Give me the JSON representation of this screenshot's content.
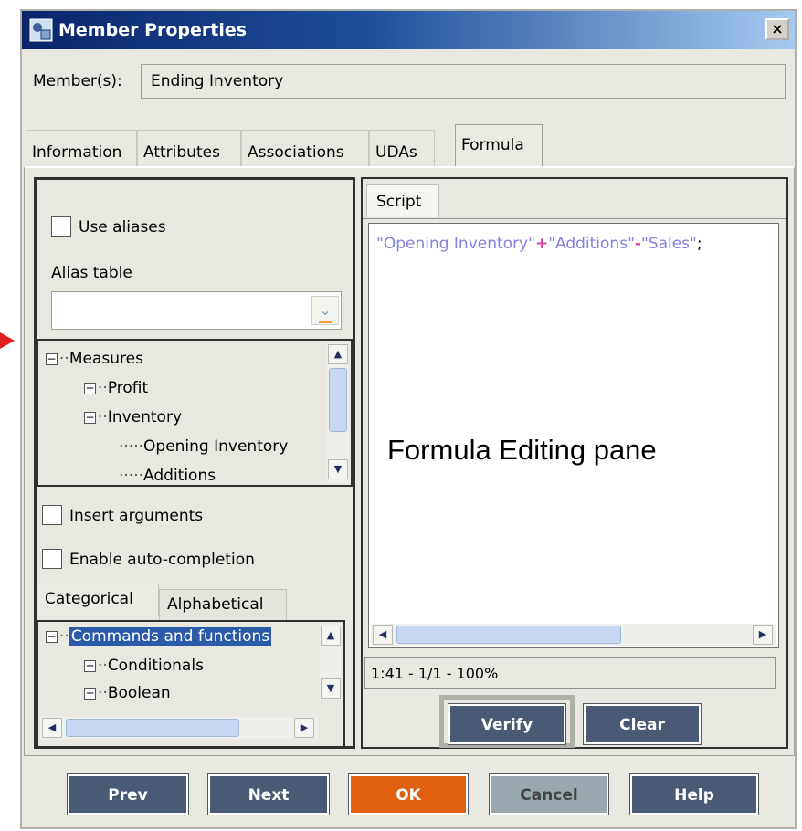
{
  "window": {
    "title": "Member Properties",
    "close_label": "×"
  },
  "member": {
    "label": "Member(s):",
    "value": "Ending Inventory"
  },
  "tabs": [
    {
      "label": "Information"
    },
    {
      "label": "Attributes"
    },
    {
      "label": "Associations"
    },
    {
      "label": "UDAs"
    },
    {
      "label": "Formula",
      "active": true
    }
  ],
  "left": {
    "use_aliases_label": "Use aliases",
    "alias_table_label": "Alias table",
    "alias_table_value": "",
    "outline_tree": [
      {
        "label": "Measures",
        "expander": "−"
      },
      {
        "label": "Profit",
        "expander": "+"
      },
      {
        "label": "Inventory",
        "expander": "−"
      },
      {
        "label": "Opening Inventory",
        "expander": ""
      },
      {
        "label": "Additions",
        "expander": ""
      }
    ],
    "insert_arguments_label": "Insert arguments",
    "enable_autocompletion_label": "Enable auto-completion",
    "subtabs": [
      {
        "label": "Categorical",
        "active": true
      },
      {
        "label": "Alphabetical"
      }
    ],
    "function_tree": [
      {
        "label": "Commands and functions",
        "expander": "−",
        "selected": true
      },
      {
        "label": "Conditionals",
        "expander": "+"
      },
      {
        "label": "Boolean",
        "expander": "+"
      }
    ]
  },
  "right": {
    "tab_label": "Script",
    "code": {
      "part1": "\"Opening Inventory\"",
      "op1": "+",
      "part2": "\"Additions\"",
      "op2": "-",
      "part3": "\"Sales\"",
      "end": ";"
    },
    "overlay_label": "Formula Editing pane",
    "status": "1:41 - 1/1 - 100%",
    "verify_label": "Verify",
    "clear_label": "Clear"
  },
  "footer": {
    "prev_label": "Prev",
    "next_label": "Next",
    "ok_label": "OK",
    "cancel_label": "Cancel",
    "help_label": "Help"
  },
  "colors": {
    "title_gradient_start": "#0a246a",
    "ok_button": "#e06010",
    "dark_button": "#4a5a74",
    "code_string": "#8080e0",
    "code_operator": "#e040a0",
    "selection": "#2a5aa8"
  }
}
